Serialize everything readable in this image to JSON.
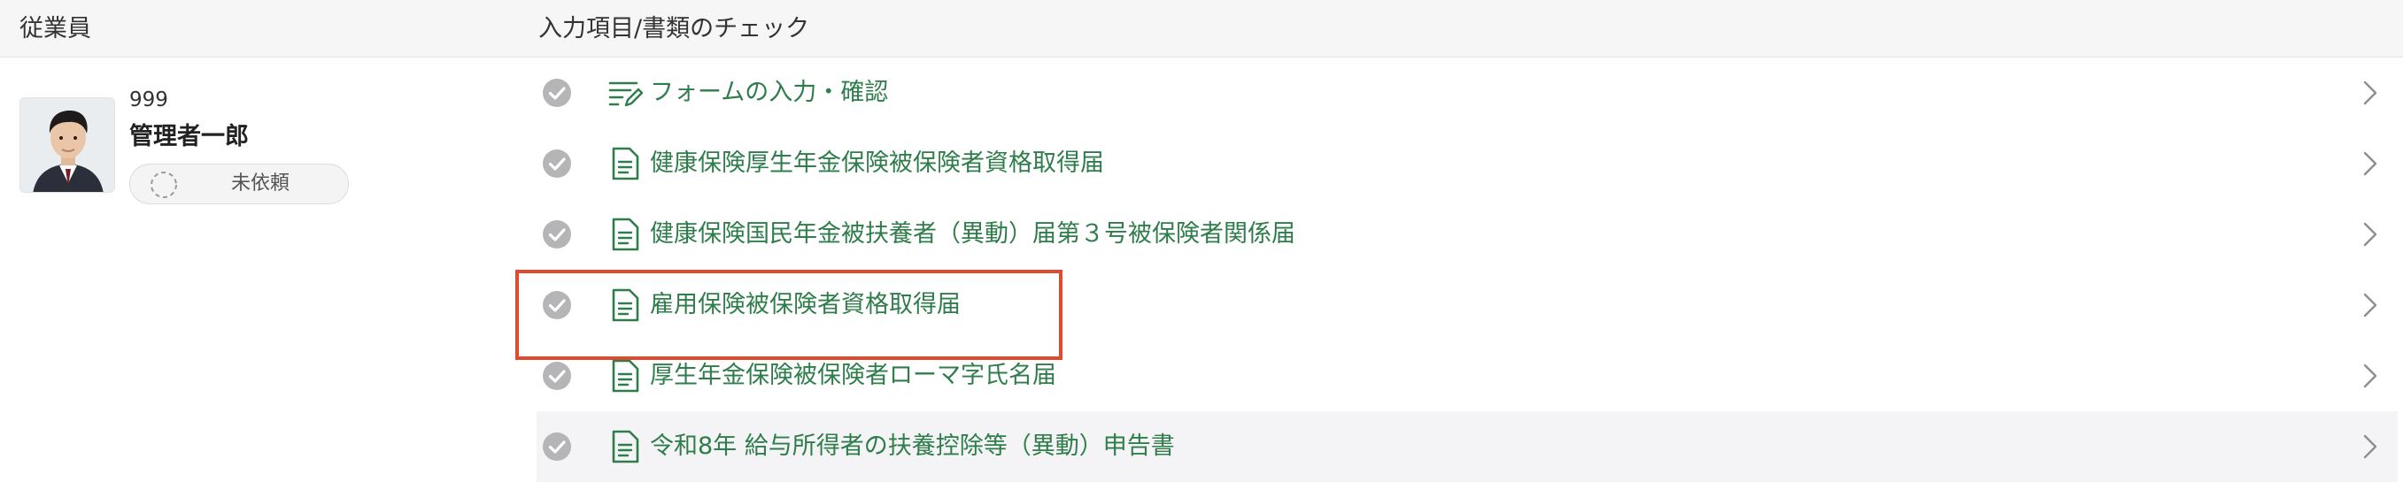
{
  "header": {
    "employee_col": "従業員",
    "items_col": "入力項目/書類のチェック"
  },
  "employee": {
    "number": "999",
    "name": "管理者一郎",
    "status": "未依頼",
    "avatar_icon": "person-photo"
  },
  "items": [
    {
      "label": "フォームの入力・確認",
      "icon": "form-edit-icon",
      "checked": true
    },
    {
      "label": "健康保険厚生年金保険被保険者資格取得届",
      "icon": "document-icon",
      "checked": true
    },
    {
      "label": "健康保険国民年金被扶養者（異動）届第３号被保険者関係届",
      "icon": "document-icon",
      "checked": true
    },
    {
      "label": "雇用保険被保険者資格取得届",
      "icon": "document-icon",
      "checked": true
    },
    {
      "label": "厚生年金保険被保険者ローマ字氏名届",
      "icon": "document-icon",
      "checked": true
    },
    {
      "label": "令和8年 給与所得者の扶養控除等（異動）申告書",
      "icon": "document-icon",
      "checked": true
    }
  ],
  "colors": {
    "accent_green": "#2e7d4a",
    "check_gray": "#b5b5b8",
    "highlight_red": "#e04a2f"
  }
}
